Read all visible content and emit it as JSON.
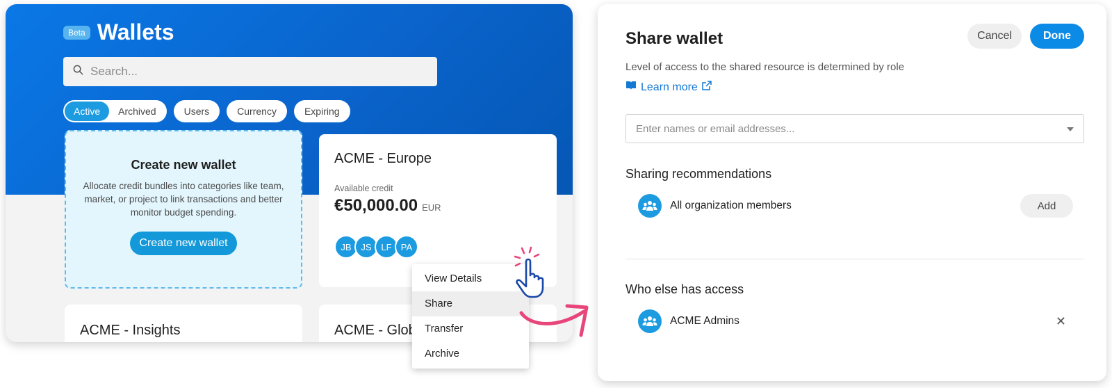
{
  "wallets": {
    "beta_badge": "Beta",
    "title": "Wallets",
    "search_placeholder": "Search...",
    "filters": {
      "active": "Active",
      "archived": "Archived",
      "users": "Users",
      "currency": "Currency",
      "expiring": "Expiring"
    },
    "create_card": {
      "title": "Create new wallet",
      "description": "Allocate credit bundles into categories like team, market, or project to link transactions and better monitor budget spending.",
      "button": "Create new wallet"
    },
    "europe_card": {
      "title": "ACME - Europe",
      "credit_label": "Available credit",
      "credit_value": "€50,000.00",
      "currency": "EUR",
      "avatars": [
        "JB",
        "JS",
        "LF",
        "PA"
      ]
    },
    "insights_card": {
      "title": "ACME - Insights"
    },
    "global_card": {
      "title": "ACME - Glob"
    }
  },
  "context_menu": {
    "items": [
      "View Details",
      "Share",
      "Transfer",
      "Archive"
    ],
    "highlighted": "Share"
  },
  "share_panel": {
    "title": "Share wallet",
    "cancel": "Cancel",
    "done": "Done",
    "description": "Level of access to the shared resource is determined by role",
    "learn_more": "Learn more",
    "input_placeholder": "Enter names or email addresses...",
    "recommendations_heading": "Sharing recommendations",
    "recommendation": {
      "label": "All organization members",
      "action": "Add"
    },
    "access_heading": "Who else has access",
    "access_entry": {
      "label": "ACME Admins"
    }
  },
  "colors": {
    "brand_blue": "#0a78e6",
    "accent": "#1d9be0",
    "done_button": "#0b8ae6",
    "arrow_pink": "#e8457a"
  }
}
